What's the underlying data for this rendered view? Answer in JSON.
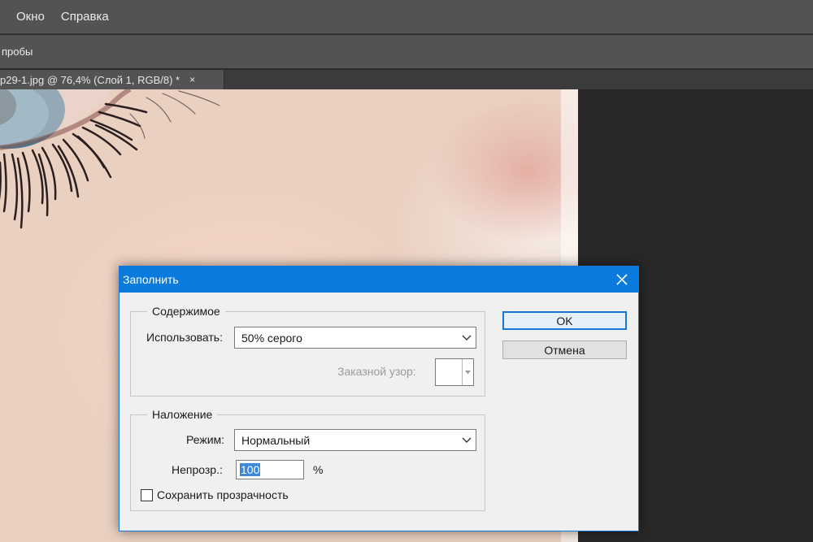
{
  "menubar": {
    "items": [
      "Окно",
      "Справка"
    ]
  },
  "optionsbar": {
    "label": "пробы"
  },
  "document_tab": {
    "title": "p29-1.jpg @ 76,4% (Слой 1, RGB/8) *",
    "close_glyph": "×"
  },
  "dialog": {
    "title": "Заполнить",
    "content_group": {
      "legend": "Содержимое",
      "use_label": "Использовать:",
      "use_value": "50% серого",
      "custom_pattern_label": "Заказной узор:"
    },
    "blend_group": {
      "legend": "Наложение",
      "mode_label": "Режим:",
      "mode_value": "Нормальный",
      "opacity_label": "Непрозр.:",
      "opacity_value": "100",
      "opacity_unit": "%",
      "preserve_transparency_label": "Сохранить прозрачность",
      "preserve_transparency_checked": false
    },
    "ok_label": "OK",
    "cancel_label": "Отмена"
  },
  "icons": {
    "dialog_close": "close-icon",
    "dropdown": "chevron-down-icon"
  },
  "colors": {
    "titlebar": "#0a7bdc",
    "ui_panel": "#535353",
    "workspace": "#282828",
    "selection": "#3b87d8"
  }
}
